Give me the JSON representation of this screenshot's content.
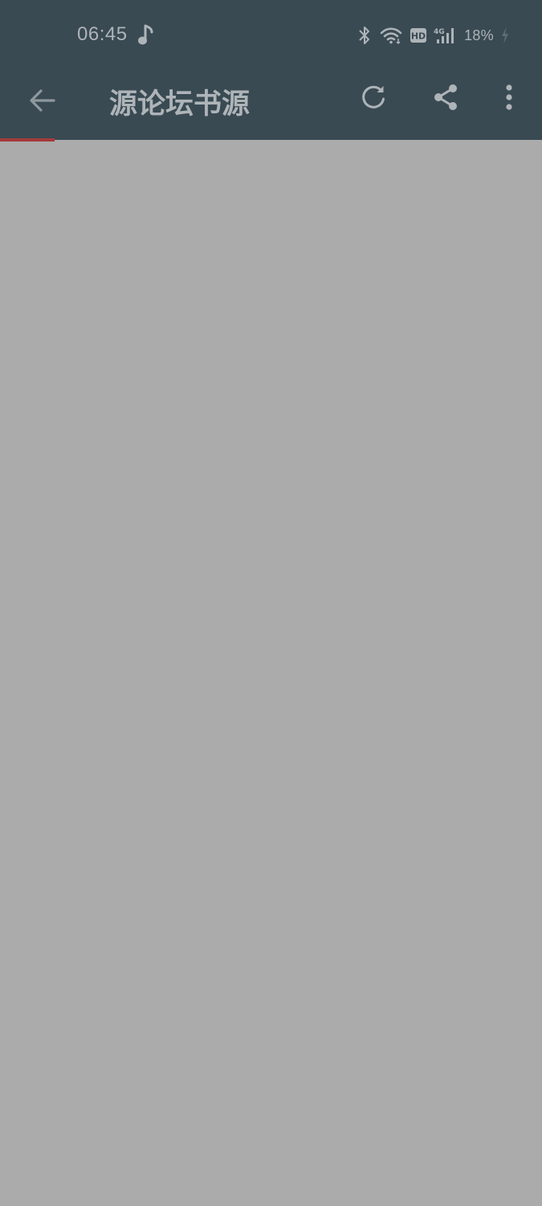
{
  "status_bar": {
    "time": "06:45",
    "battery_percent": "18%",
    "icons": [
      "music-note-icon",
      "bluetooth-icon",
      "wifi-icon",
      "hd-icon",
      "4g-signal-icon",
      "charging-bolt-icon"
    ]
  },
  "app_bar": {
    "title": "源论坛书源",
    "icons": [
      "back-arrow-icon",
      "refresh-icon",
      "share-icon",
      "more-vert-icon"
    ]
  },
  "page_load": {
    "progress": 0.1
  },
  "colors": {
    "app_bar": "#394a53",
    "content_overlay": "#ababab",
    "foreground": "#aeb4b8",
    "progress": "#a33a3a"
  }
}
